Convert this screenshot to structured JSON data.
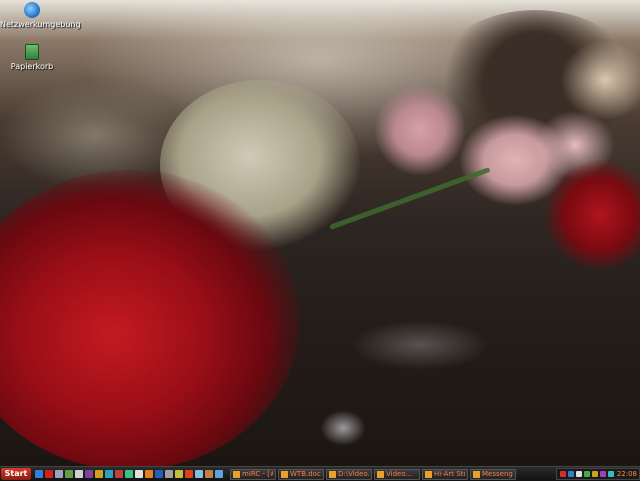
{
  "desktop": {
    "icons": [
      {
        "label": "Netzwerkumgebung",
        "icon": "network-places-icon"
      },
      {
        "label": "Papierkorb",
        "icon": "recycle-bin-icon"
      }
    ]
  },
  "taskbar": {
    "start_label": "Start",
    "quick_launch": [
      {
        "icon": "browser-icon",
        "color": "#3a7ad8"
      },
      {
        "icon": "opera-icon",
        "color": "#d02020"
      },
      {
        "icon": "mail-icon",
        "color": "#a0a0c0"
      },
      {
        "icon": "app-icon",
        "color": "#60a040"
      },
      {
        "icon": "app-icon",
        "color": "#d0d0d0"
      },
      {
        "icon": "app-icon",
        "color": "#8040a0"
      },
      {
        "icon": "app-icon",
        "color": "#d0a020"
      },
      {
        "icon": "app-icon",
        "color": "#30a0c0"
      },
      {
        "icon": "app-icon",
        "color": "#c04040"
      },
      {
        "icon": "app-icon",
        "color": "#40c080"
      },
      {
        "icon": "app-icon",
        "color": "#e0e0e0"
      },
      {
        "icon": "app-icon",
        "color": "#e08020"
      },
      {
        "icon": "app-icon",
        "color": "#2060c0"
      },
      {
        "icon": "app-icon",
        "color": "#a0a0a0"
      },
      {
        "icon": "app-icon",
        "color": "#c0c040"
      },
      {
        "icon": "app-icon",
        "color": "#e04020"
      },
      {
        "icon": "app-icon",
        "color": "#80c0e0"
      },
      {
        "icon": "app-icon",
        "color": "#c08040"
      },
      {
        "icon": "app-icon",
        "color": "#60a0e0"
      }
    ],
    "tasks": [
      {
        "label": "mIRC - [#..."
      },
      {
        "label": "WTB.doc"
      },
      {
        "label": "D:\\Video..."
      },
      {
        "label": "Video..."
      },
      {
        "label": "Hi-Art Sto..."
      },
      {
        "label": "Messenger"
      }
    ],
    "tray_icons": [
      {
        "icon": "tray-icon",
        "color": "#d03030"
      },
      {
        "icon": "tray-icon",
        "color": "#3080d0"
      },
      {
        "icon": "tray-icon",
        "color": "#e0e0e0"
      },
      {
        "icon": "tray-icon",
        "color": "#40b040"
      },
      {
        "icon": "tray-icon",
        "color": "#d0a020"
      },
      {
        "icon": "tray-icon",
        "color": "#a040c0"
      },
      {
        "icon": "tray-icon",
        "color": "#30c0c0"
      }
    ],
    "clock": "22:08"
  },
  "colors": {
    "taskbar": "#1a1a1a",
    "task_text": "#ff7a4a",
    "start": "#c82a1a"
  }
}
